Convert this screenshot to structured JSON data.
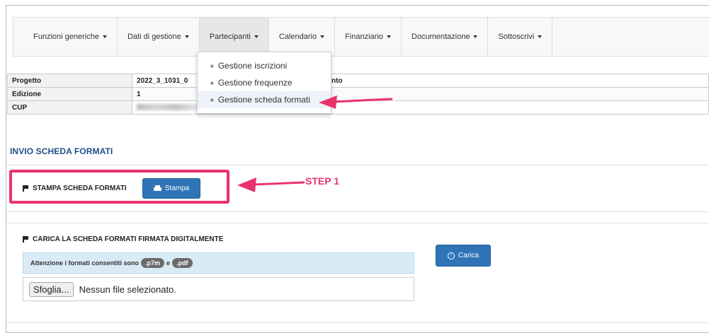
{
  "nav": {
    "items": [
      {
        "label": "Funzioni generiche"
      },
      {
        "label": "Dati di gestione"
      },
      {
        "label": "Partecipanti"
      },
      {
        "label": "Calendario"
      },
      {
        "label": "Finanziario"
      },
      {
        "label": "Documentazione"
      },
      {
        "label": "Sottoscrivi"
      }
    ],
    "active": "Partecipanti"
  },
  "dropdown": {
    "items": [
      {
        "label": "Gestione iscrizioni"
      },
      {
        "label": "Gestione frequenze"
      },
      {
        "label": "Gestione scheda formati"
      }
    ],
    "highlighted": "Gestione scheda formati"
  },
  "info": {
    "rows": [
      {
        "label": "Progetto",
        "value": "2022_3_1031_0",
        "extra": "Trento"
      },
      {
        "label": "Edizione",
        "value": "1"
      },
      {
        "label": "CUP",
        "value": ""
      }
    ]
  },
  "section": {
    "title": "INVIO SCHEDA FORMATI"
  },
  "step1": {
    "label": "STAMPA SCHEDA FORMATI",
    "button": "Stampa",
    "annotation": "STEP 1"
  },
  "upload": {
    "title": "CARICA LA SCHEDA FORMATI FIRMATA DIGITALMENTE",
    "alert_text": "Attenzione i formati consentiti sono",
    "alert_and": "e",
    "formats": [
      ".p7m",
      ".pdf"
    ],
    "file_button": "Sfoglia...",
    "file_status": "Nessun file selezionato.",
    "upload_button": "Carica"
  },
  "colors": {
    "accent_pink": "#e8336d",
    "button_blue": "#2f74b7",
    "title_blue": "#1f4e88",
    "alert_bg": "#d9ebf5"
  }
}
